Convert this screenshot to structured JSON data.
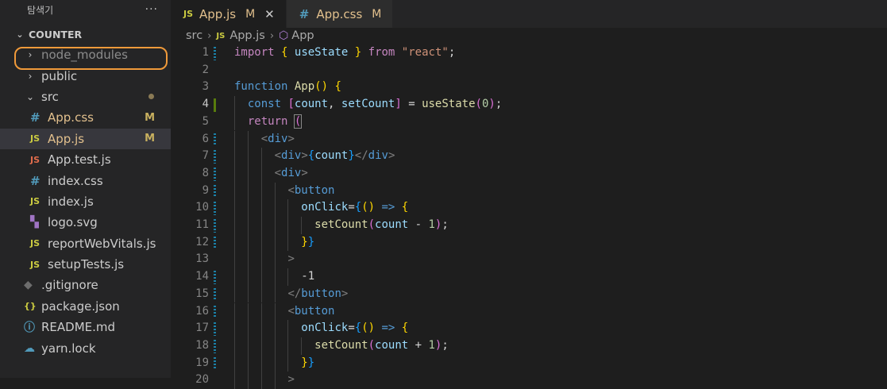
{
  "sidebar": {
    "title": "탐색기",
    "more": "···",
    "section": "COUNTER",
    "items": [
      {
        "name": "node_modules",
        "type": "folder",
        "open": false,
        "depth": 1
      },
      {
        "name": "public",
        "type": "folder",
        "open": false,
        "depth": 1
      },
      {
        "name": "src",
        "type": "folder",
        "open": true,
        "depth": 1,
        "dot": true
      },
      {
        "name": "App.css",
        "icon": "#",
        "icon_name": "css-icon",
        "depth": 2,
        "status": "M"
      },
      {
        "name": "App.js",
        "icon": "JS",
        "icon_name": "js-icon",
        "depth": 2,
        "status": "M",
        "selected": true
      },
      {
        "name": "App.test.js",
        "icon": "JS",
        "icon_name": "test-js-icon",
        "depth": 2
      },
      {
        "name": "index.css",
        "icon": "#",
        "icon_name": "css-icon",
        "depth": 2
      },
      {
        "name": "index.js",
        "icon": "JS",
        "icon_name": "js-icon",
        "depth": 2
      },
      {
        "name": "logo.svg",
        "icon": "▚",
        "icon_name": "svg-icon",
        "depth": 2
      },
      {
        "name": "reportWebVitals.js",
        "icon": "JS",
        "icon_name": "js-icon",
        "depth": 2
      },
      {
        "name": "setupTests.js",
        "icon": "JS",
        "icon_name": "js-icon",
        "depth": 2
      },
      {
        "name": ".gitignore",
        "icon": "◆",
        "icon_name": "git-icon",
        "depth": 1
      },
      {
        "name": "package.json",
        "icon": "{}",
        "icon_name": "json-icon",
        "depth": 1
      },
      {
        "name": "README.md",
        "icon": "ⓘ",
        "icon_name": "info-icon",
        "depth": 1
      },
      {
        "name": "yarn.lock",
        "icon": "☁",
        "icon_name": "yarn-icon",
        "depth": 1
      }
    ]
  },
  "tabs": [
    {
      "label": "App.js",
      "icon": "JS",
      "status": "M",
      "close": "✕",
      "active": true
    },
    {
      "label": "App.css",
      "icon": "#",
      "status": "M",
      "active": false
    }
  ],
  "breadcrumb": {
    "folder": "src",
    "file_icon": "JS",
    "file": "App.js",
    "symbol": "App"
  },
  "editor": {
    "active_line": 4,
    "lines": [
      {
        "n": "1",
        "mark": "mod",
        "tokens": [
          [
            "k",
            "import"
          ],
          [
            "pl",
            " "
          ],
          [
            "p1",
            "{"
          ],
          [
            "pl",
            " "
          ],
          [
            "v",
            "useState"
          ],
          [
            "pl",
            " "
          ],
          [
            "p1",
            "}"
          ],
          [
            "pl",
            " "
          ],
          [
            "k",
            "from"
          ],
          [
            "pl",
            " "
          ],
          [
            "s",
            "\"react\""
          ],
          [
            "pl",
            ";"
          ]
        ]
      },
      {
        "n": "2",
        "tokens": []
      },
      {
        "n": "3",
        "tokens": [
          [
            "kb",
            "function"
          ],
          [
            "pl",
            " "
          ],
          [
            "fn",
            "App"
          ],
          [
            "p1",
            "()"
          ],
          [
            "pl",
            " "
          ],
          [
            "p1",
            "{"
          ]
        ]
      },
      {
        "n": "4",
        "mark": "add",
        "indent": 1,
        "tokens": [
          [
            "kb",
            "const"
          ],
          [
            "pl",
            " "
          ],
          [
            "p2",
            "["
          ],
          [
            "v",
            "count"
          ],
          [
            "pl",
            ", "
          ],
          [
            "v",
            "setCount"
          ],
          [
            "p2",
            "]"
          ],
          [
            "pl",
            " = "
          ],
          [
            "fn",
            "useState"
          ],
          [
            "p2",
            "("
          ],
          [
            "n",
            "0"
          ],
          [
            "p2",
            ")"
          ],
          [
            "pl",
            ";"
          ]
        ]
      },
      {
        "n": "5",
        "indent": 1,
        "tokens": [
          [
            "k",
            "return"
          ],
          [
            "pl",
            " "
          ],
          [
            "p2",
            "(",
            "hl"
          ]
        ]
      },
      {
        "n": "6",
        "mark": "mod",
        "indent": 2,
        "tokens": [
          [
            "tg",
            "<"
          ],
          [
            "t",
            "div"
          ],
          [
            "tg",
            ">"
          ]
        ]
      },
      {
        "n": "7",
        "mark": "mod",
        "indent": 3,
        "tokens": [
          [
            "tg",
            "<"
          ],
          [
            "t",
            "div"
          ],
          [
            "tg",
            ">"
          ],
          [
            "p3",
            "{"
          ],
          [
            "v",
            "count"
          ],
          [
            "p3",
            "}"
          ],
          [
            "tg",
            "</"
          ],
          [
            "t",
            "div"
          ],
          [
            "tg",
            ">"
          ]
        ]
      },
      {
        "n": "8",
        "mark": "mod",
        "indent": 3,
        "tokens": [
          [
            "tg",
            "<"
          ],
          [
            "t",
            "div"
          ],
          [
            "tg",
            ">"
          ]
        ]
      },
      {
        "n": "9",
        "mark": "mod",
        "indent": 4,
        "tokens": [
          [
            "tg",
            "<"
          ],
          [
            "t",
            "button"
          ]
        ]
      },
      {
        "n": "10",
        "mark": "mod",
        "indent": 5,
        "tokens": [
          [
            "v",
            "onClick"
          ],
          [
            "pl",
            "="
          ],
          [
            "p3",
            "{"
          ],
          [
            "p1",
            "()"
          ],
          [
            "pl",
            " "
          ],
          [
            "kb",
            "=>"
          ],
          [
            "pl",
            " "
          ],
          [
            "p1",
            "{"
          ]
        ]
      },
      {
        "n": "11",
        "mark": "mod",
        "indent": 6,
        "tokens": [
          [
            "fn",
            "setCount"
          ],
          [
            "p2",
            "("
          ],
          [
            "v",
            "count"
          ],
          [
            "pl",
            " - "
          ],
          [
            "n",
            "1"
          ],
          [
            "p2",
            ")"
          ],
          [
            "pl",
            ";"
          ]
        ]
      },
      {
        "n": "12",
        "mark": "mod",
        "indent": 5,
        "tokens": [
          [
            "p1",
            "}"
          ],
          [
            "p3",
            "}"
          ]
        ]
      },
      {
        "n": "13",
        "indent": 4,
        "tokens": [
          [
            "tg",
            ">"
          ]
        ]
      },
      {
        "n": "14",
        "mark": "mod",
        "indent": 5,
        "tokens": [
          [
            "pl",
            "-1"
          ]
        ]
      },
      {
        "n": "15",
        "mark": "mod",
        "indent": 4,
        "tokens": [
          [
            "tg",
            "</"
          ],
          [
            "t",
            "button"
          ],
          [
            "tg",
            ">"
          ]
        ]
      },
      {
        "n": "16",
        "mark": "mod",
        "indent": 4,
        "tokens": [
          [
            "tg",
            "<"
          ],
          [
            "t",
            "button"
          ]
        ]
      },
      {
        "n": "17",
        "mark": "mod",
        "indent": 5,
        "tokens": [
          [
            "v",
            "onClick"
          ],
          [
            "pl",
            "="
          ],
          [
            "p3",
            "{"
          ],
          [
            "p1",
            "()"
          ],
          [
            "pl",
            " "
          ],
          [
            "kb",
            "=>"
          ],
          [
            "pl",
            " "
          ],
          [
            "p1",
            "{"
          ]
        ]
      },
      {
        "n": "18",
        "mark": "mod",
        "indent": 6,
        "tokens": [
          [
            "fn",
            "setCount"
          ],
          [
            "p2",
            "("
          ],
          [
            "v",
            "count"
          ],
          [
            "pl",
            " + "
          ],
          [
            "n",
            "1"
          ],
          [
            "p2",
            ")"
          ],
          [
            "pl",
            ";"
          ]
        ]
      },
      {
        "n": "19",
        "mark": "mod",
        "indent": 5,
        "tokens": [
          [
            "p1",
            "}"
          ],
          [
            "p3",
            "}"
          ]
        ]
      },
      {
        "n": "20",
        "indent": 4,
        "tokens": [
          [
            "tg",
            ">"
          ]
        ]
      }
    ]
  }
}
